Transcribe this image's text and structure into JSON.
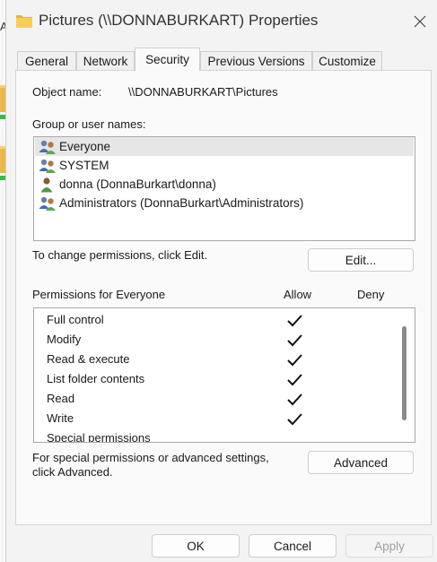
{
  "background": {
    "letter": "A"
  },
  "window": {
    "title": "Pictures (\\\\DONNABURKART) Properties",
    "close_label": "Close"
  },
  "tabs": [
    {
      "label": "General",
      "active": false
    },
    {
      "label": "Network",
      "active": false
    },
    {
      "label": "Security",
      "active": true
    },
    {
      "label": "Previous Versions",
      "active": false
    },
    {
      "label": "Customize",
      "active": false
    }
  ],
  "security": {
    "object_name_label": "Object name:",
    "object_name_value": "\\\\DONNABURKART\\Pictures",
    "group_label": "Group or user names:",
    "groups": [
      {
        "name": "Everyone",
        "icon": "group-users-icon",
        "selected": true
      },
      {
        "name": "SYSTEM",
        "icon": "group-users-icon",
        "selected": false
      },
      {
        "name": "donna (DonnaBurkart\\donna)",
        "icon": "user-icon",
        "selected": false
      },
      {
        "name": "Administrators (DonnaBurkart\\Administrators)",
        "icon": "group-users-icon",
        "selected": false
      }
    ],
    "change_hint": "To change permissions, click Edit.",
    "edit_button": "Edit...",
    "permissions_label": "Permissions for Everyone",
    "allow_header": "Allow",
    "deny_header": "Deny",
    "permissions": [
      {
        "name": "Full control",
        "allow": true,
        "deny": false
      },
      {
        "name": "Modify",
        "allow": true,
        "deny": false
      },
      {
        "name": "Read & execute",
        "allow": true,
        "deny": false
      },
      {
        "name": "List folder contents",
        "allow": true,
        "deny": false
      },
      {
        "name": "Read",
        "allow": true,
        "deny": false
      },
      {
        "name": "Write",
        "allow": true,
        "deny": false
      },
      {
        "name": "Special permissions",
        "allow": false,
        "deny": false
      }
    ],
    "advanced_hint_line1": "For special permissions or advanced settings,",
    "advanced_hint_line2": "click Advanced.",
    "advanced_button": "Advanced"
  },
  "footer": {
    "ok": "OK",
    "cancel": "Cancel",
    "apply": "Apply"
  },
  "colors": {
    "window_bg": "#f3f3f3",
    "panel_bg": "#fafafa",
    "selection": "#e6e6e6",
    "folder": "#f0c040"
  }
}
